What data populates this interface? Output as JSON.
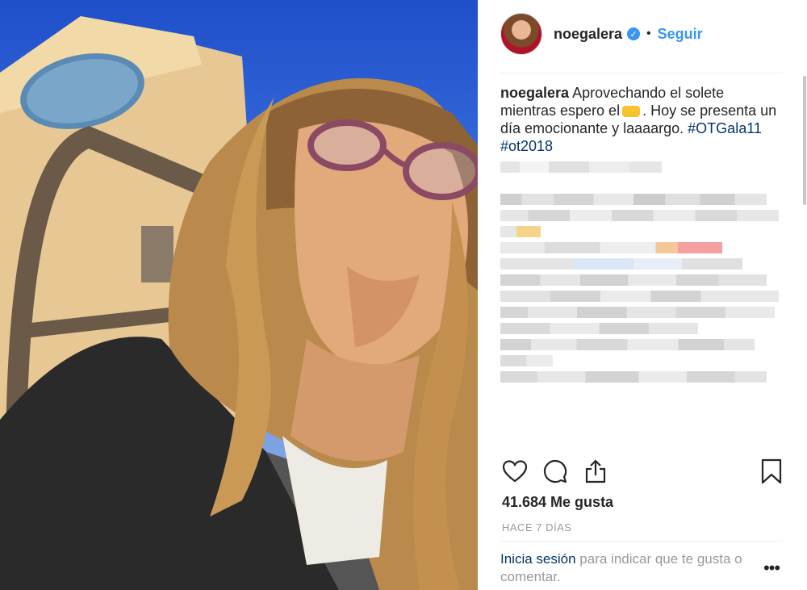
{
  "post": {
    "username": "noegalera",
    "follow_label": "Seguir",
    "caption_user": "noegalera",
    "caption_text": "Aprovechando el solete mientras espero el",
    "caption_text2": ". Hoy se presenta un día emocionante y laaaargo.",
    "hashtag1": "#OTGala11",
    "hashtag2": "#ot2018",
    "likes": "41.684 Me gusta",
    "time": "HACE 7 DÍAS",
    "login_link": "Inicia sesión",
    "login_text": "para indicar que te gusta o comentar.",
    "more_label": "•••"
  },
  "icons": {
    "verified": "verified-badge-icon",
    "like": "heart-icon",
    "comment": "comment-icon",
    "share": "share-icon",
    "save": "bookmark-icon",
    "emoji": "taxi-emoji-icon"
  },
  "colors": {
    "link": "#3897f0",
    "hashtag": "#003569",
    "muted": "#999999"
  }
}
